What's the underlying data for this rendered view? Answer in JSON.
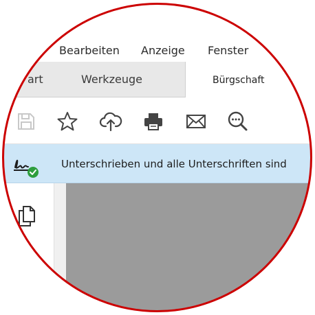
{
  "menu": {
    "items": [
      "Bearbeiten",
      "Anzeige",
      "Fenster"
    ]
  },
  "tabs": {
    "start_partial": "art",
    "tools": "Werkzeuge",
    "document": "Bürgschaft"
  },
  "toolbar": {
    "icons": [
      "save-icon",
      "star-icon",
      "cloud-upload-icon",
      "print-icon",
      "mail-icon",
      "search-zoom-icon"
    ]
  },
  "signature_bar": {
    "message": "Unterschrieben und alle Unterschriften sind"
  },
  "colors": {
    "ring": "#cc0000",
    "signature_bar": "#cde6f7",
    "document_area": "#9b9b9b",
    "check_badge": "#2e9e3e"
  }
}
